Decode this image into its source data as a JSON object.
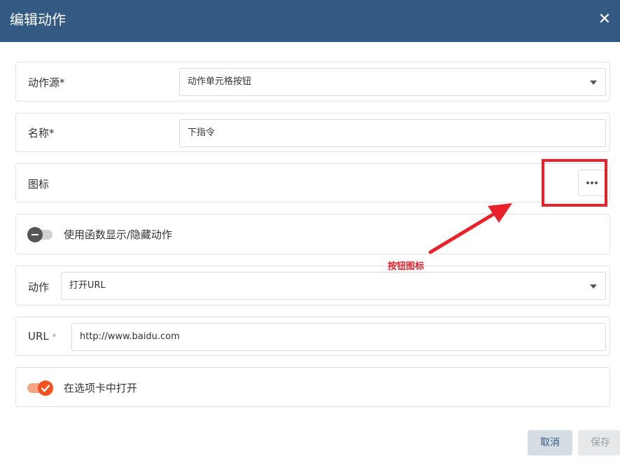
{
  "dialog": {
    "title": "编辑动作"
  },
  "fields": {
    "action_source": {
      "label": "动作源*",
      "value": "动作单元格按钮"
    },
    "name": {
      "label": "名称*",
      "value": "下指令"
    },
    "icon": {
      "label": "图标"
    },
    "toggle_visibility": {
      "label": "使用函数显示/隐藏动作",
      "state": "off"
    },
    "action": {
      "label": "动作",
      "value": "打开URL"
    },
    "url": {
      "label": "URL",
      "required_mark": "*",
      "value": "http://www.baidu.com"
    },
    "open_in_tab": {
      "label": "在选项卡中打开",
      "state": "on"
    }
  },
  "annotation": {
    "text": "按钮图标",
    "color": "#e8212b"
  },
  "footer": {
    "cancel_label": "取消",
    "save_label": "保存"
  },
  "colors": {
    "header": "#325a82",
    "accent": "#f4511e",
    "annotation": "#e8212b"
  }
}
